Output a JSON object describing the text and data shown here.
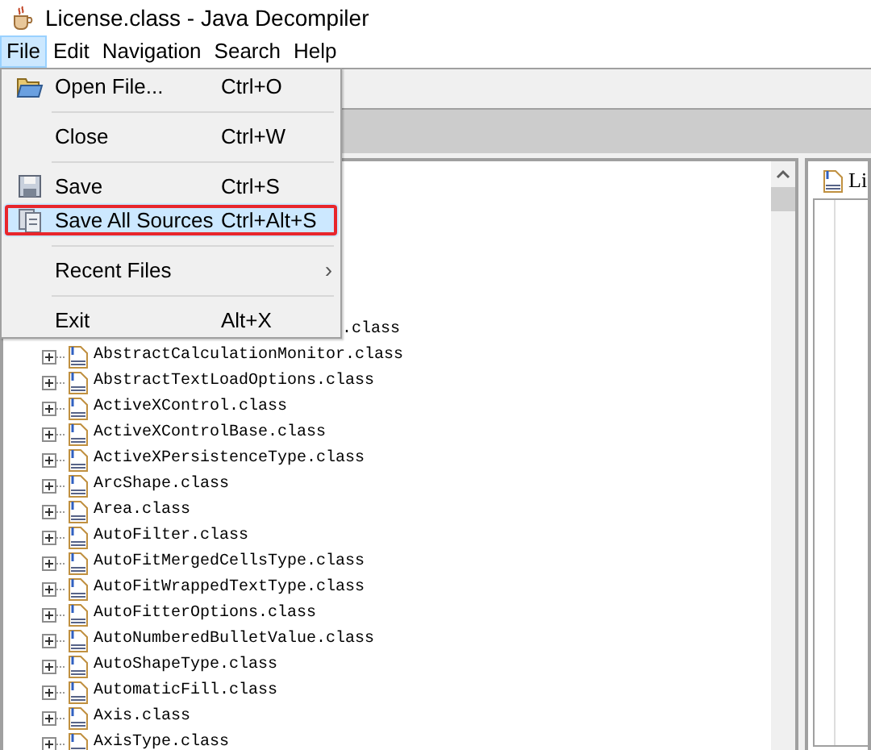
{
  "window": {
    "title": "License.class - Java Decompiler"
  },
  "menubar": [
    {
      "label": "File",
      "selected": true
    },
    {
      "label": "Edit",
      "selected": false
    },
    {
      "label": "Navigation",
      "selected": false
    },
    {
      "label": "Search",
      "selected": false
    },
    {
      "label": "Help",
      "selected": false
    }
  ],
  "file_menu": [
    {
      "kind": "item",
      "label": "Open File...",
      "shortcut": "Ctrl+O",
      "selected": false,
      "outlined": false
    },
    {
      "kind": "separator"
    },
    {
      "kind": "item",
      "label": "Close",
      "shortcut": "Ctrl+W",
      "selected": false,
      "outlined": false
    },
    {
      "kind": "separator"
    },
    {
      "kind": "item",
      "label": "Save",
      "shortcut": "Ctrl+S",
      "selected": false,
      "outlined": false
    },
    {
      "kind": "item",
      "label": "Save All Sources",
      "shortcut": "Ctrl+Alt+S",
      "selected": true,
      "outlined": true
    },
    {
      "kind": "separator"
    },
    {
      "kind": "submenu",
      "label": "Recent Files",
      "arrow": "›",
      "selected": false,
      "outlined": false
    },
    {
      "kind": "separator"
    },
    {
      "kind": "item",
      "label": "Exit",
      "shortcut": "Alt+X",
      "selected": false,
      "outlined": false
    }
  ],
  "tree": [
    {
      "kind": "covered",
      "label": ".class"
    },
    {
      "kind": "class",
      "label": "AbstractCalculationMonitor.class"
    },
    {
      "kind": "class",
      "label": "AbstractTextLoadOptions.class"
    },
    {
      "kind": "class",
      "label": "ActiveXControl.class"
    },
    {
      "kind": "class",
      "label": "ActiveXControlBase.class"
    },
    {
      "kind": "class",
      "label": "ActiveXPersistenceType.class"
    },
    {
      "kind": "class",
      "label": "ArcShape.class"
    },
    {
      "kind": "class",
      "label": "Area.class"
    },
    {
      "kind": "class",
      "label": "AutoFilter.class"
    },
    {
      "kind": "class",
      "label": "AutoFitMergedCellsType.class"
    },
    {
      "kind": "class",
      "label": "AutoFitWrappedTextType.class"
    },
    {
      "kind": "class",
      "label": "AutoFitterOptions.class"
    },
    {
      "kind": "class",
      "label": "AutoNumberedBulletValue.class"
    },
    {
      "kind": "class",
      "label": "AutoShapeType.class"
    },
    {
      "kind": "class",
      "label": "AutomaticFill.class"
    },
    {
      "kind": "class",
      "label": "Axis.class"
    },
    {
      "kind": "class",
      "label": "AxisType.class"
    }
  ],
  "editor_tab": {
    "label": "Li"
  }
}
